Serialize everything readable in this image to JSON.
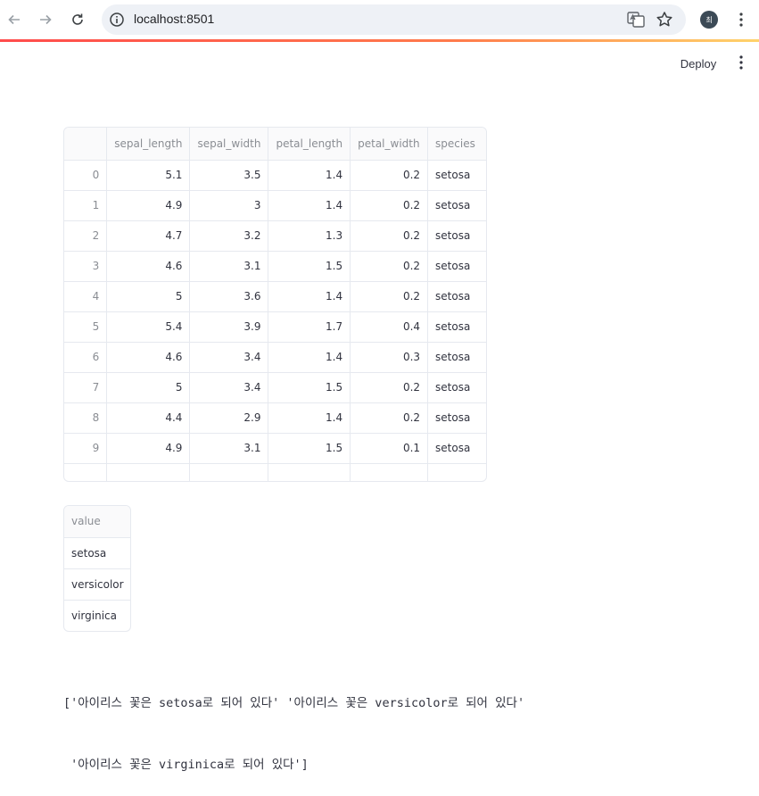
{
  "browser": {
    "url": "localhost:8501",
    "avatar_initial": "최"
  },
  "header": {
    "deploy_label": "Deploy"
  },
  "dataframe": {
    "columns": [
      "",
      "sepal_length",
      "sepal_width",
      "petal_length",
      "petal_width",
      "species"
    ],
    "rows": [
      [
        "0",
        "5.1",
        "3.5",
        "1.4",
        "0.2",
        "setosa"
      ],
      [
        "1",
        "4.9",
        "3",
        "1.4",
        "0.2",
        "setosa"
      ],
      [
        "2",
        "4.7",
        "3.2",
        "1.3",
        "0.2",
        "setosa"
      ],
      [
        "3",
        "4.6",
        "3.1",
        "1.5",
        "0.2",
        "setosa"
      ],
      [
        "4",
        "5",
        "3.6",
        "1.4",
        "0.2",
        "setosa"
      ],
      [
        "5",
        "5.4",
        "3.9",
        "1.7",
        "0.4",
        "setosa"
      ],
      [
        "6",
        "4.6",
        "3.4",
        "1.4",
        "0.3",
        "setosa"
      ],
      [
        "7",
        "5",
        "3.4",
        "1.5",
        "0.2",
        "setosa"
      ],
      [
        "8",
        "4.4",
        "2.9",
        "1.4",
        "0.2",
        "setosa"
      ],
      [
        "9",
        "4.9",
        "3.1",
        "1.5",
        "0.1",
        "setosa"
      ]
    ]
  },
  "value_table": {
    "header": "value",
    "rows": [
      "setosa",
      "versicolor",
      "virginica"
    ]
  },
  "output": {
    "line1": "['아이리스 꽃은 setosa로 되어 있다' '아이리스 꽃은 versicolor로 되어 있다'",
    "line2": " '아이리스 꽃은 virginica로 되어 있다']"
  }
}
